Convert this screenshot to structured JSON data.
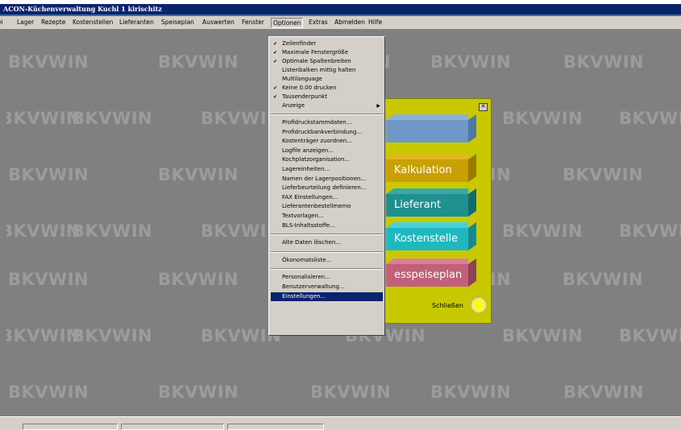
{
  "window": {
    "title": "ACON-Küchenverwaltung Kuchl 1  kirischitz"
  },
  "menubar": {
    "items": [
      "ei",
      "Lager",
      "Rezepte",
      "Kostenstellen",
      "Lieferanten",
      "Speiseplan",
      "Auswerten",
      "Fenster",
      "Optionen",
      "Extras",
      "Abmelden",
      "Hilfe"
    ],
    "active": "Optionen"
  },
  "watermark": {
    "text": "BKVWIN"
  },
  "options_menu": {
    "items": [
      {
        "label": "Zeilenfinder",
        "checked": true
      },
      {
        "label": "Maximale Fenstergröße",
        "checked": true
      },
      {
        "label": "Optimale Spaltenbreiten",
        "checked": true
      },
      {
        "label": "Listenbalken mittig halten",
        "checked": false
      },
      {
        "label": "Multilanguage",
        "checked": false
      },
      {
        "label": "Keine 0.00 drucken",
        "checked": true
      },
      {
        "label": "Tausenderpunkt",
        "checked": true
      },
      {
        "label": "Anzeige",
        "checked": false,
        "submenu": true
      },
      {
        "label": "Profidruckstammdaten...",
        "checked": false
      },
      {
        "label": "Profidruckbankverbindung...",
        "checked": false
      },
      {
        "label": "Kostenträger zuordnen...",
        "checked": false
      },
      {
        "label": "Logfile anzeigen...",
        "checked": false
      },
      {
        "label": "Kochplatzorganisation...",
        "checked": false
      },
      {
        "label": "Lagereinheiten...",
        "checked": false
      },
      {
        "label": "Namen der Lagerpositionen...",
        "checked": false
      },
      {
        "label": "Lieferbeurteilung definieren...",
        "checked": false
      },
      {
        "label": "FAX Einstellungen...",
        "checked": false
      },
      {
        "label": "Lieferantenbestellmemo",
        "checked": false
      },
      {
        "label": "Textvorlagen...",
        "checked": false
      },
      {
        "label": "BLS-Inhaltsstoffe...",
        "checked": false
      },
      {
        "label": "Alte Daten löschen...",
        "checked": false
      },
      {
        "label": "Ökonomatsliste...",
        "checked": false
      },
      {
        "label": "Personalisieren...",
        "checked": false
      },
      {
        "label": "Benutzerverwaltung...",
        "checked": false
      },
      {
        "label": "Einstellungen...",
        "checked": false,
        "highlighted": true
      }
    ],
    "check_glyph": "✔",
    "arrow_glyph": "▶"
  },
  "panel": {
    "close_glyph": "✕",
    "blocks": [
      {
        "label": "",
        "color": "#6f98c6",
        "top": "#8fb1d9",
        "side": "#4f78a6"
      },
      {
        "label": "Kalkulation",
        "color": "#c8a000",
        "top": "#e0b820",
        "side": "#9a7a00"
      },
      {
        "label": "Lieferant",
        "color": "#1f8f8f",
        "top": "#3aa8a8",
        "side": "#136a6a"
      },
      {
        "label": "Kostenstelle",
        "color": "#20b8c0",
        "top": "#48d0d8",
        "side": "#168a90"
      },
      {
        "label": "esspeiseplan",
        "color": "#c0607a",
        "top": "#d88098",
        "side": "#8e4058"
      }
    ],
    "close_button_label": "Schließen"
  }
}
